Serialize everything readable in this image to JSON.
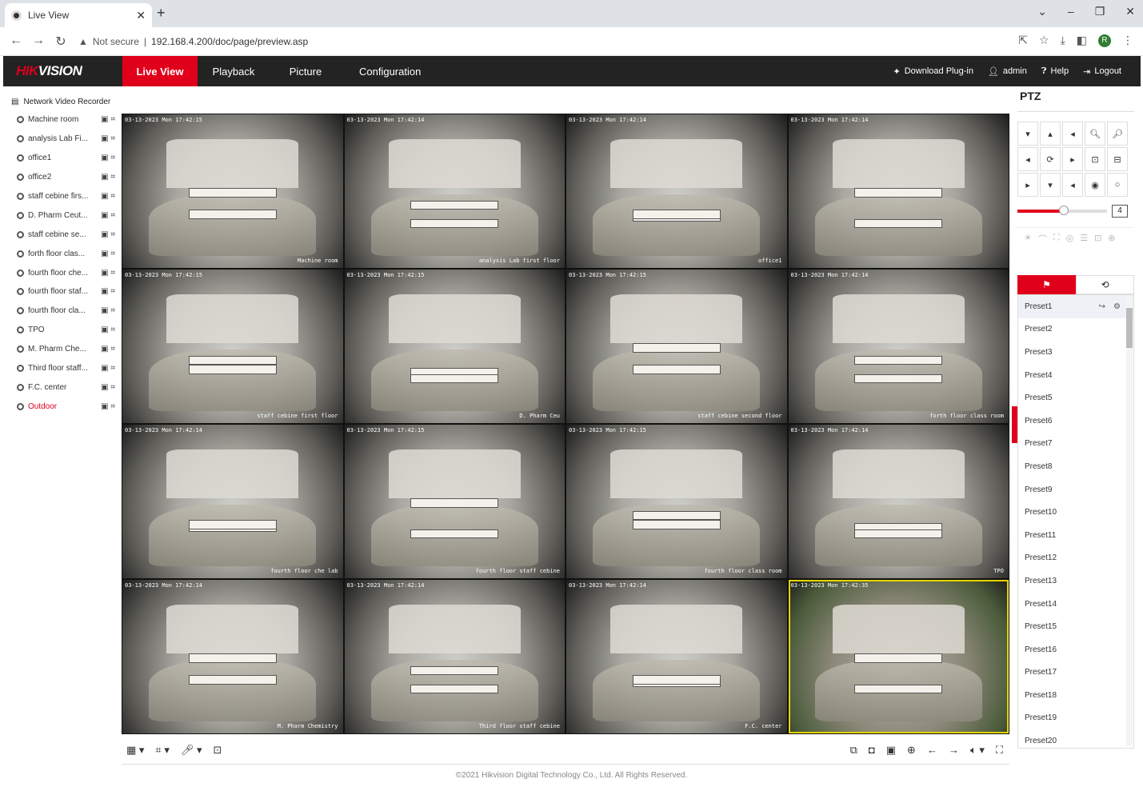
{
  "browser": {
    "tab_title": "Live View",
    "new_tab": "+",
    "address_warning": "Not secure",
    "url": "192.168.4.200/doc/page/preview.asp",
    "profile_initial": "R"
  },
  "header": {
    "logo_hik": "HIK",
    "logo_vision": "VISION",
    "nav": [
      "Live View",
      "Playback",
      "Picture",
      "Configuration"
    ],
    "download_plugin": "Download Plug-in",
    "user": "admin",
    "help": "Help",
    "logout": "Logout"
  },
  "tree": {
    "root": "Network Video Recorder",
    "cameras": [
      "Machine room",
      "analysis Lab Fi...",
      "office1",
      "office2",
      "staff cebine firs...",
      "D. Pharm Ceut...",
      "staff cebine se...",
      "forth floor clas...",
      "fourth floor che...",
      "fourth floor staf...",
      "fourth floor cla...",
      "TPO",
      "M. Pharm Che...",
      "Third floor staff...",
      "F.C. center",
      "Outdoor"
    ],
    "active_camera_color": "#d9001b"
  },
  "video": {
    "tiles": [
      {
        "ts": "03-13-2023 Mon 17:42:15",
        "label": "Machine room"
      },
      {
        "ts": "03-13-2023 Mon 17:42:14",
        "label": "analysis Lab first floor"
      },
      {
        "ts": "03-13-2023 Mon 17:42:14",
        "label": "office1"
      },
      {
        "ts": "03-13-2023 Mon 17:42:14",
        "label": ""
      },
      {
        "ts": "03-13-2023 Mon 17:42:15",
        "label": "staff cebine first floor"
      },
      {
        "ts": "03-13-2023 Mon 17:42:15",
        "label": "D. Pharm Ceu"
      },
      {
        "ts": "03-13-2023 Mon 17:42:15",
        "label": "staff cebine second floor"
      },
      {
        "ts": "03-13-2023 Mon 17:42:14",
        "label": "forth floor class room"
      },
      {
        "ts": "03-13-2023 Mon 17:42:14",
        "label": "fourth floor che lab"
      },
      {
        "ts": "03-13-2023 Mon 17:42:15",
        "label": "fourth floor staff cebine"
      },
      {
        "ts": "03-13-2023 Mon 17:42:15",
        "label": "fourth floor class room"
      },
      {
        "ts": "03-13-2023 Mon 17:42:14",
        "label": "TPO"
      },
      {
        "ts": "03-13-2023 Mon 17:42:14",
        "label": "M. Pharm Chemistry"
      },
      {
        "ts": "03-13-2023 Mon 17:42:14",
        "label": "Third floor staff cebine"
      },
      {
        "ts": "03-13-2023 Mon 17:42:14",
        "label": "F.C. center"
      },
      {
        "ts": "03-13-2023 Mon 17:42:35",
        "label": ""
      }
    ]
  },
  "ptz": {
    "title": "PTZ",
    "speed": "4",
    "presets": [
      "Preset1",
      "Preset2",
      "Preset3",
      "Preset4",
      "Preset5",
      "Preset6",
      "Preset7",
      "Preset8",
      "Preset9",
      "Preset10",
      "Preset11",
      "Preset12",
      "Preset13",
      "Preset14",
      "Preset15",
      "Preset16",
      "Preset17",
      "Preset18",
      "Preset19",
      "Preset20"
    ]
  },
  "footer": {
    "copyright": "©2021 Hikvision Digital Technology Co., Ltd. All Rights Reserved."
  },
  "colors": {
    "brand_red": "#e1001b",
    "header_bg": "#232323"
  }
}
